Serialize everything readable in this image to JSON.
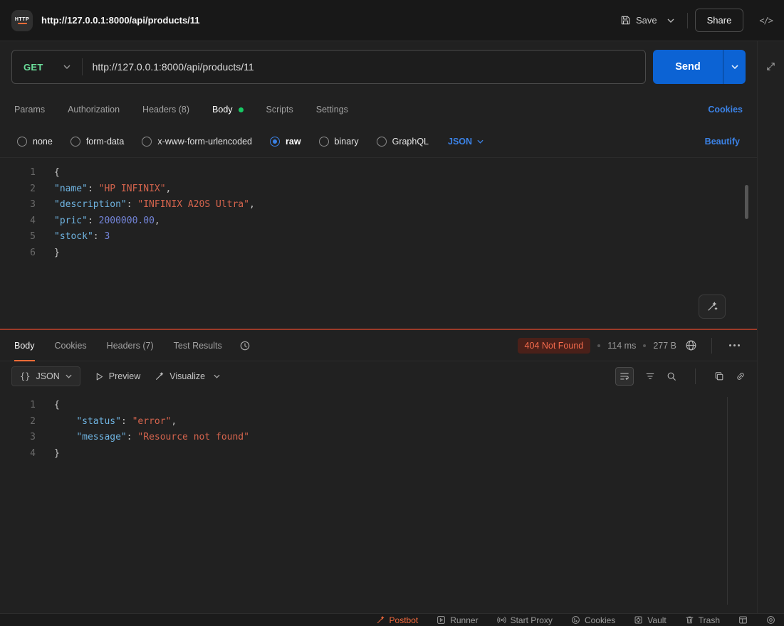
{
  "topbar": {
    "logo_text": "HTTP",
    "title": "http://127.0.0.1:8000/api/products/11",
    "save_label": "Save",
    "share_label": "Share",
    "code_icon_glyph": "</>"
  },
  "request": {
    "method": "GET",
    "url": "http://127.0.0.1:8000/api/products/11",
    "send_label": "Send",
    "cookies_link": "Cookies",
    "tabs": [
      "Params",
      "Authorization",
      "Headers (8)",
      "Body",
      "Scripts",
      "Settings"
    ],
    "active_tab": "Body",
    "body_types": [
      "none",
      "form-data",
      "x-www-form-urlencoded",
      "raw",
      "binary",
      "GraphQL"
    ],
    "selected_body_type": "raw",
    "raw_language": "JSON",
    "beautify_label": "Beautify",
    "body_lines": [
      {
        "n": "1",
        "tokens": [
          {
            "c": "p",
            "t": "{"
          }
        ]
      },
      {
        "n": "2",
        "tokens": [
          {
            "c": "k",
            "t": "\"name\""
          },
          {
            "c": "p",
            "t": ": "
          },
          {
            "c": "s",
            "t": "\"HP INFINIX\""
          },
          {
            "c": "p",
            "t": ","
          }
        ]
      },
      {
        "n": "3",
        "tokens": [
          {
            "c": "k",
            "t": "\"description\""
          },
          {
            "c": "p",
            "t": ": "
          },
          {
            "c": "s",
            "t": "\"INFINIX A20S Ultra\""
          },
          {
            "c": "p",
            "t": ","
          }
        ]
      },
      {
        "n": "4",
        "tokens": [
          {
            "c": "k",
            "t": "\"pric\""
          },
          {
            "c": "p",
            "t": ": "
          },
          {
            "c": "n",
            "t": "2000000.00"
          },
          {
            "c": "p",
            "t": ","
          }
        ]
      },
      {
        "n": "5",
        "tokens": [
          {
            "c": "k",
            "t": "\"stock\""
          },
          {
            "c": "p",
            "t": ": "
          },
          {
            "c": "n",
            "t": "3"
          }
        ]
      },
      {
        "n": "6",
        "tokens": [
          {
            "c": "p",
            "t": "}"
          }
        ]
      }
    ]
  },
  "response": {
    "tabs": [
      "Body",
      "Cookies",
      "Headers (7)",
      "Test Results"
    ],
    "active_tab": "Body",
    "status": "404 Not Found",
    "time": "114 ms",
    "size": "277 B",
    "format": "JSON",
    "preview_label": "Preview",
    "visualize_label": "Visualize",
    "body_lines": [
      {
        "n": "1",
        "tokens": [
          {
            "c": "p",
            "t": "{"
          }
        ]
      },
      {
        "n": "2",
        "tokens": [
          {
            "c": "p",
            "t": "    "
          },
          {
            "c": "k",
            "t": "\"status\""
          },
          {
            "c": "p",
            "t": ": "
          },
          {
            "c": "s",
            "t": "\"error\""
          },
          {
            "c": "p",
            "t": ","
          }
        ]
      },
      {
        "n": "3",
        "tokens": [
          {
            "c": "p",
            "t": "    "
          },
          {
            "c": "k",
            "t": "\"message\""
          },
          {
            "c": "p",
            "t": ": "
          },
          {
            "c": "s",
            "t": "\"Resource not found\""
          }
        ]
      },
      {
        "n": "4",
        "tokens": [
          {
            "c": "p",
            "t": "}"
          }
        ]
      }
    ]
  },
  "statusbar": {
    "items": [
      "Postbot",
      "Runner",
      "Start Proxy",
      "Cookies",
      "Vault",
      "Trash"
    ]
  },
  "colors": {
    "send_blue": "#0c63d4",
    "link_blue": "#3b82e6",
    "postman_orange": "#ff6c37",
    "error_red": "#f66b4d",
    "method_get_green": "#6bdd9a",
    "body_dot_green": "#17c964",
    "statusbar_accent": "#f0683c"
  }
}
